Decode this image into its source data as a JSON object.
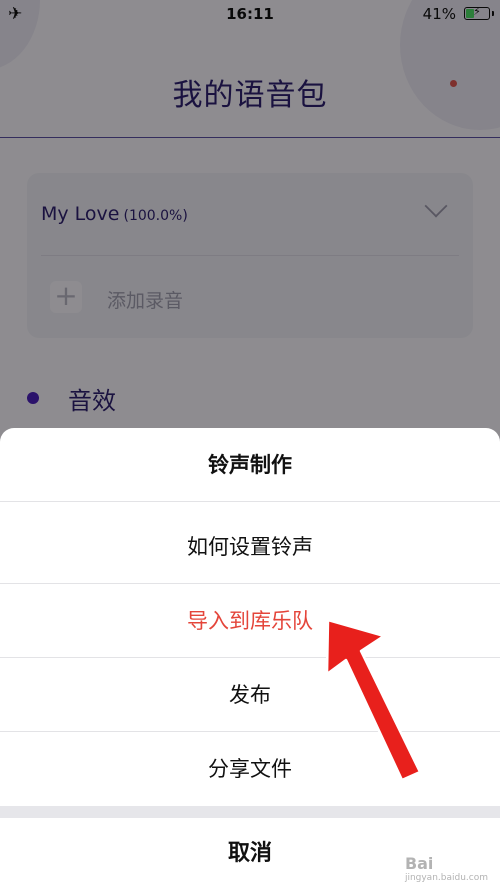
{
  "status_bar": {
    "time": "16:11",
    "battery_percent": "41%",
    "airplane_icon": "airplane-icon",
    "battery_level": 0.41
  },
  "page": {
    "title": "我的语音包"
  },
  "voice_card": {
    "name": "My Love",
    "percent": "(100.0%)",
    "add_label": "添加录音"
  },
  "section": {
    "label": "音效"
  },
  "action_sheet": {
    "title": "铃声制作",
    "items": [
      {
        "label": "如何设置铃声"
      },
      {
        "label": "导入到库乐队"
      },
      {
        "label": "发布"
      },
      {
        "label": "分享文件"
      }
    ],
    "cancel_label": "取消"
  },
  "colors": {
    "accent": "#2e1f6e",
    "highlight": "#e4453a",
    "arrow": "#e8201c",
    "battery": "#4cd964"
  },
  "watermark": {
    "text": "Bai",
    "sub": "jingyan.baidu.com"
  }
}
